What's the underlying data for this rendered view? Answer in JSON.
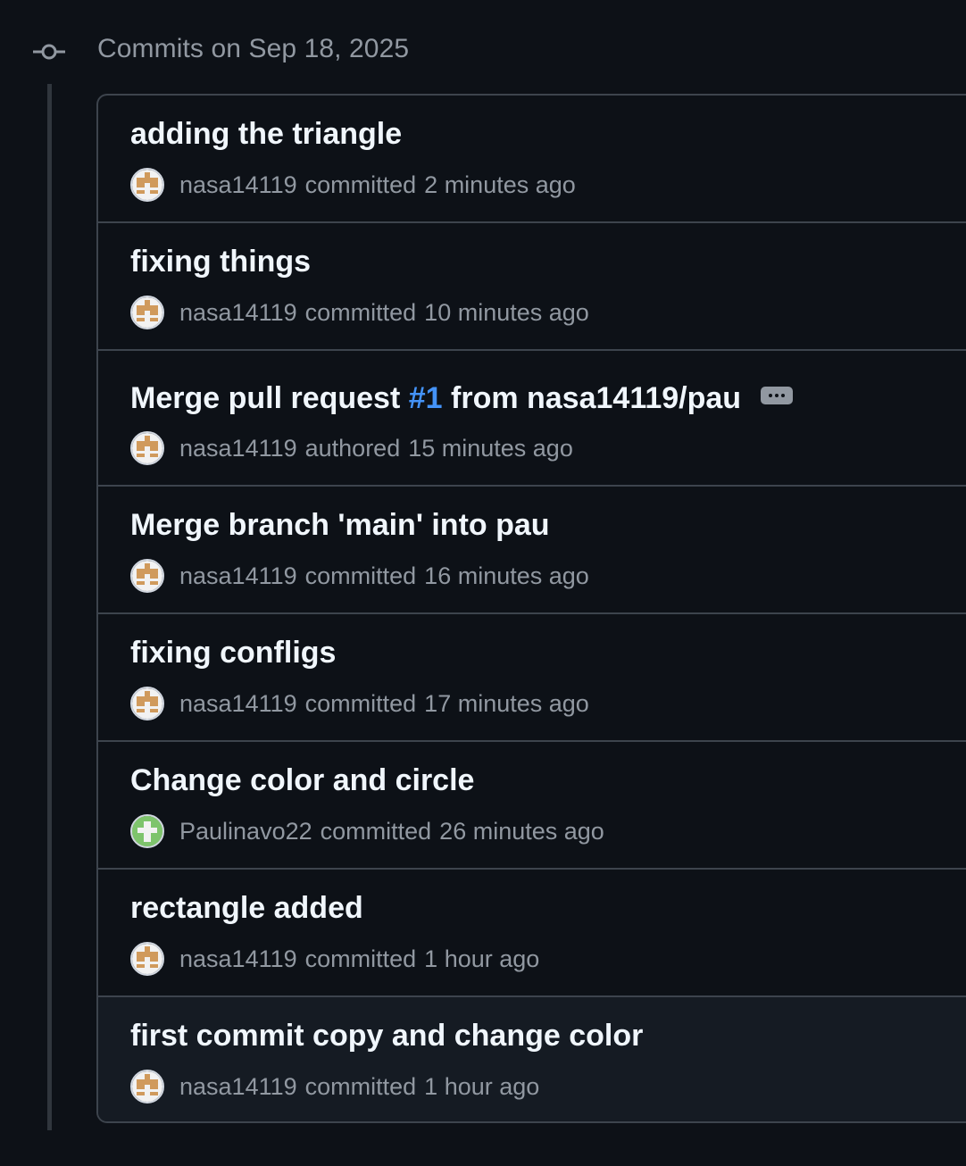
{
  "group": {
    "heading": "Commits on Sep 18, 2025"
  },
  "commits": [
    {
      "title": "adding the triangle",
      "author": "nasa14119",
      "verb": "committed",
      "time": "2 minutes ago",
      "avatar": "orange-identicon"
    },
    {
      "title": "fixing things",
      "author": "nasa14119",
      "verb": "committed",
      "time": "10 minutes ago",
      "avatar": "orange-identicon"
    },
    {
      "title_prefix": "Merge pull request ",
      "pr_link": "#1",
      "title_suffix": " from nasa14119/pau",
      "author": "nasa14119",
      "verb": "authored",
      "time": "15 minutes ago",
      "avatar": "orange-identicon",
      "has_ellipsis": true
    },
    {
      "title": "Merge branch 'main' into pau",
      "author": "nasa14119",
      "verb": "committed",
      "time": "16 minutes ago",
      "avatar": "orange-identicon"
    },
    {
      "title": "fixing confligs",
      "author": "nasa14119",
      "verb": "committed",
      "time": "17 minutes ago",
      "avatar": "orange-identicon"
    },
    {
      "title": "Change color and circle",
      "author": "Paulinavo22",
      "verb": "committed",
      "time": "26 minutes ago",
      "avatar": "green-identicon"
    },
    {
      "title": "rectangle added",
      "author": "nasa14119",
      "verb": "committed",
      "time": "1 hour ago",
      "avatar": "orange-identicon"
    },
    {
      "title": "first commit copy and change color",
      "author": "nasa14119",
      "verb": "committed",
      "time": "1 hour ago",
      "avatar": "orange-identicon"
    }
  ],
  "colors": {
    "background": "#0d1117",
    "text_primary": "#f0f6fc",
    "text_muted": "#9198a1",
    "link": "#4493f8",
    "border": "#3d444d",
    "avatar_orange": "#d09a5c",
    "avatar_green": "#7ec46c"
  }
}
